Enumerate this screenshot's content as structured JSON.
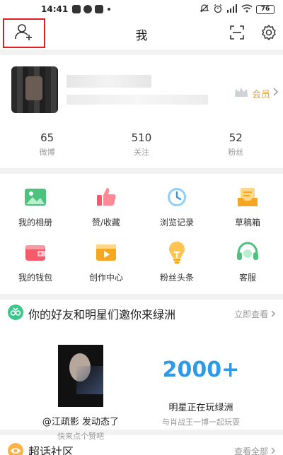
{
  "status_bar": {
    "time": "14:41",
    "battery": "76"
  },
  "header": {
    "title": "我"
  },
  "profile": {
    "vip_label": "会员",
    "stats": [
      {
        "value": "65",
        "label": "微博"
      },
      {
        "value": "510",
        "label": "关注"
      },
      {
        "value": "52",
        "label": "粉丝"
      }
    ]
  },
  "grid": {
    "items": [
      {
        "label": "我的相册",
        "icon": "photo-album-icon",
        "color": "#3cb371"
      },
      {
        "label": "赞/收藏",
        "icon": "thumbs-up-icon",
        "color": "#f45a6a"
      },
      {
        "label": "浏览记录",
        "icon": "clock-icon",
        "color": "#2f9be7"
      },
      {
        "label": "草稿箱",
        "icon": "drafts-icon",
        "color": "#f5a623"
      },
      {
        "label": "我的钱包",
        "icon": "wallet-icon",
        "color": "#f45a6a"
      },
      {
        "label": "创作中心",
        "icon": "video-icon",
        "color": "#f5a623"
      },
      {
        "label": "粉丝头条",
        "icon": "lightbulb-icon",
        "color": "#f5a623"
      },
      {
        "label": "客服",
        "icon": "headset-icon",
        "color": "#3cb371"
      }
    ]
  },
  "oasis": {
    "title": "你的好友和明星们邀你来绿洲",
    "action": "立即查看",
    "friend_name": "@江疏影 发动态了",
    "friend_sub": "快来点个赞吧",
    "star_count": "2000+",
    "star_title": "明星正在玩绿洲",
    "star_sub": "与肖战王一博一起玩耍"
  },
  "super_topic": {
    "title": "超话社区",
    "action": "查看全部"
  },
  "colors": {
    "accent_orange": "#e8a33d",
    "link_blue": "#2f9be7",
    "highlight_red": "#e02020"
  }
}
